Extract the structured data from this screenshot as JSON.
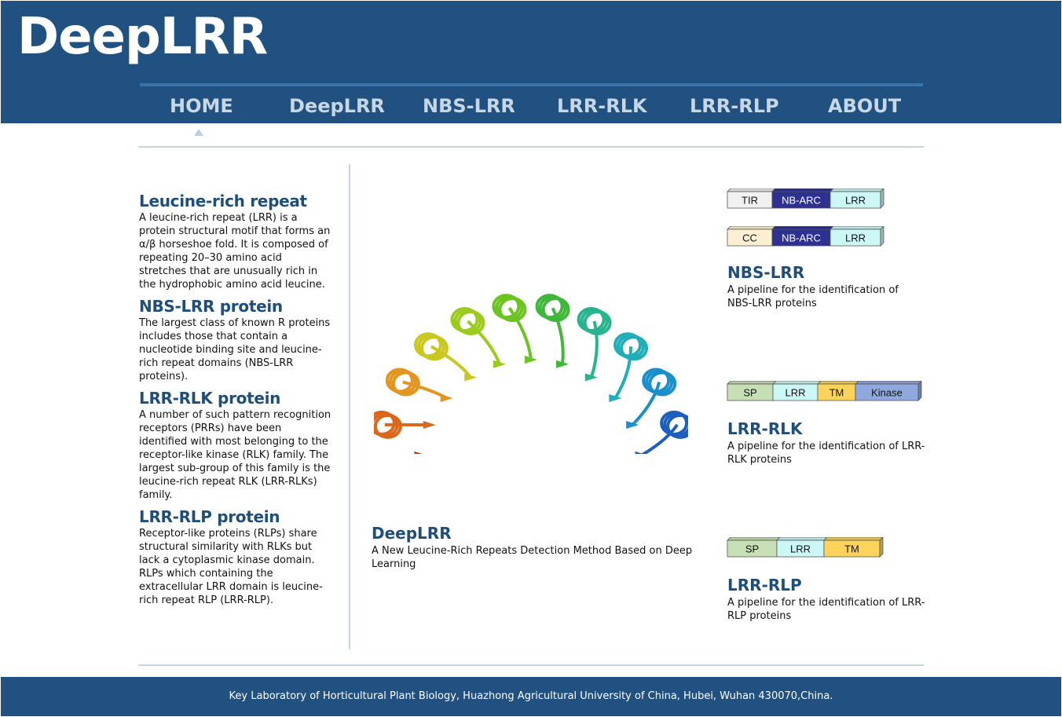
{
  "brand": "DeepLRR",
  "nav": [
    "HOME",
    "DeepLRR",
    "NBS-LRR",
    "LRR-RLK",
    "LRR-RLP",
    "ABOUT"
  ],
  "active_nav": "HOME",
  "colors": {
    "header_bg": "#215180",
    "title_blue": "#1f4e79",
    "nav_text": "#c7d7e6",
    "rule": "#c4d5e2"
  },
  "left": [
    {
      "title": "Leucine-rich repeat",
      "body": "A leucine-rich repeat (LRR) is a protein structural motif that forms an α/β horseshoe fold. It is composed of repeating 20–30 amino acid stretches that are unusually rich in the hydrophobic amino acid leucine."
    },
    {
      "title": "NBS-LRR protein",
      "body": "The largest class of known R proteins includes those that contain a nucleotide binding site and leucine-rich repeat domains (NBS-LRR proteins)."
    },
    {
      "title": "LRR-RLK protein",
      "body": "A number of such pattern recognition receptors (PRRs) have been identified with most belonging to the receptor-like kinase (RLK) family. The largest sub-group of this family is the leucine-rich repeat RLK (LRR-RLKs) family."
    },
    {
      "title": "LRR-RLP protein",
      "body": "Receptor-like proteins (RLPs) share structural similarity with RLKs but lack a cytoplasmic kinase domain. RLPs which containing the extracellular LRR domain is leucine-rich repeat RLP (LRR-RLP)."
    }
  ],
  "center": {
    "image": "LRR horseshoe protein structure ribbon",
    "title": "DeepLRR",
    "desc": "A New Leucine-Rich Repeats Detection Method Based on Deep Learning"
  },
  "right": {
    "nbs": {
      "diagrams": [
        [
          "TIR",
          "NB-ARC",
          "LRR"
        ],
        [
          "CC",
          "NB-ARC",
          "LRR"
        ]
      ],
      "title": "NBS-LRR",
      "desc": "A pipeline for the identification of NBS-LRR proteins"
    },
    "rlk": {
      "diagram": [
        "SP",
        "LRR",
        "TM",
        "Kinase"
      ],
      "title": "LRR-RLK",
      "desc": "A pipeline for the identification of LRR-RLK proteins"
    },
    "rlp": {
      "diagram": [
        "SP",
        "LRR",
        "TM"
      ],
      "title": "LRR-RLP",
      "desc": "A pipeline for the identification of LRR-RLP proteins"
    }
  },
  "domain_colors": {
    "TIR": "#f1f1f1",
    "CC": "#fdf0d2",
    "NB-ARC": "#2e3192",
    "LRR": "#ccf7f7",
    "SP": "#c7dfb4",
    "TM": "#fcd45c",
    "Kinase": "#8fa8de"
  },
  "footer": "Key Laboratory of Horticultural Plant Biology, Huazhong Agricultural University of China, Hubei, Wuhan 430070,China."
}
